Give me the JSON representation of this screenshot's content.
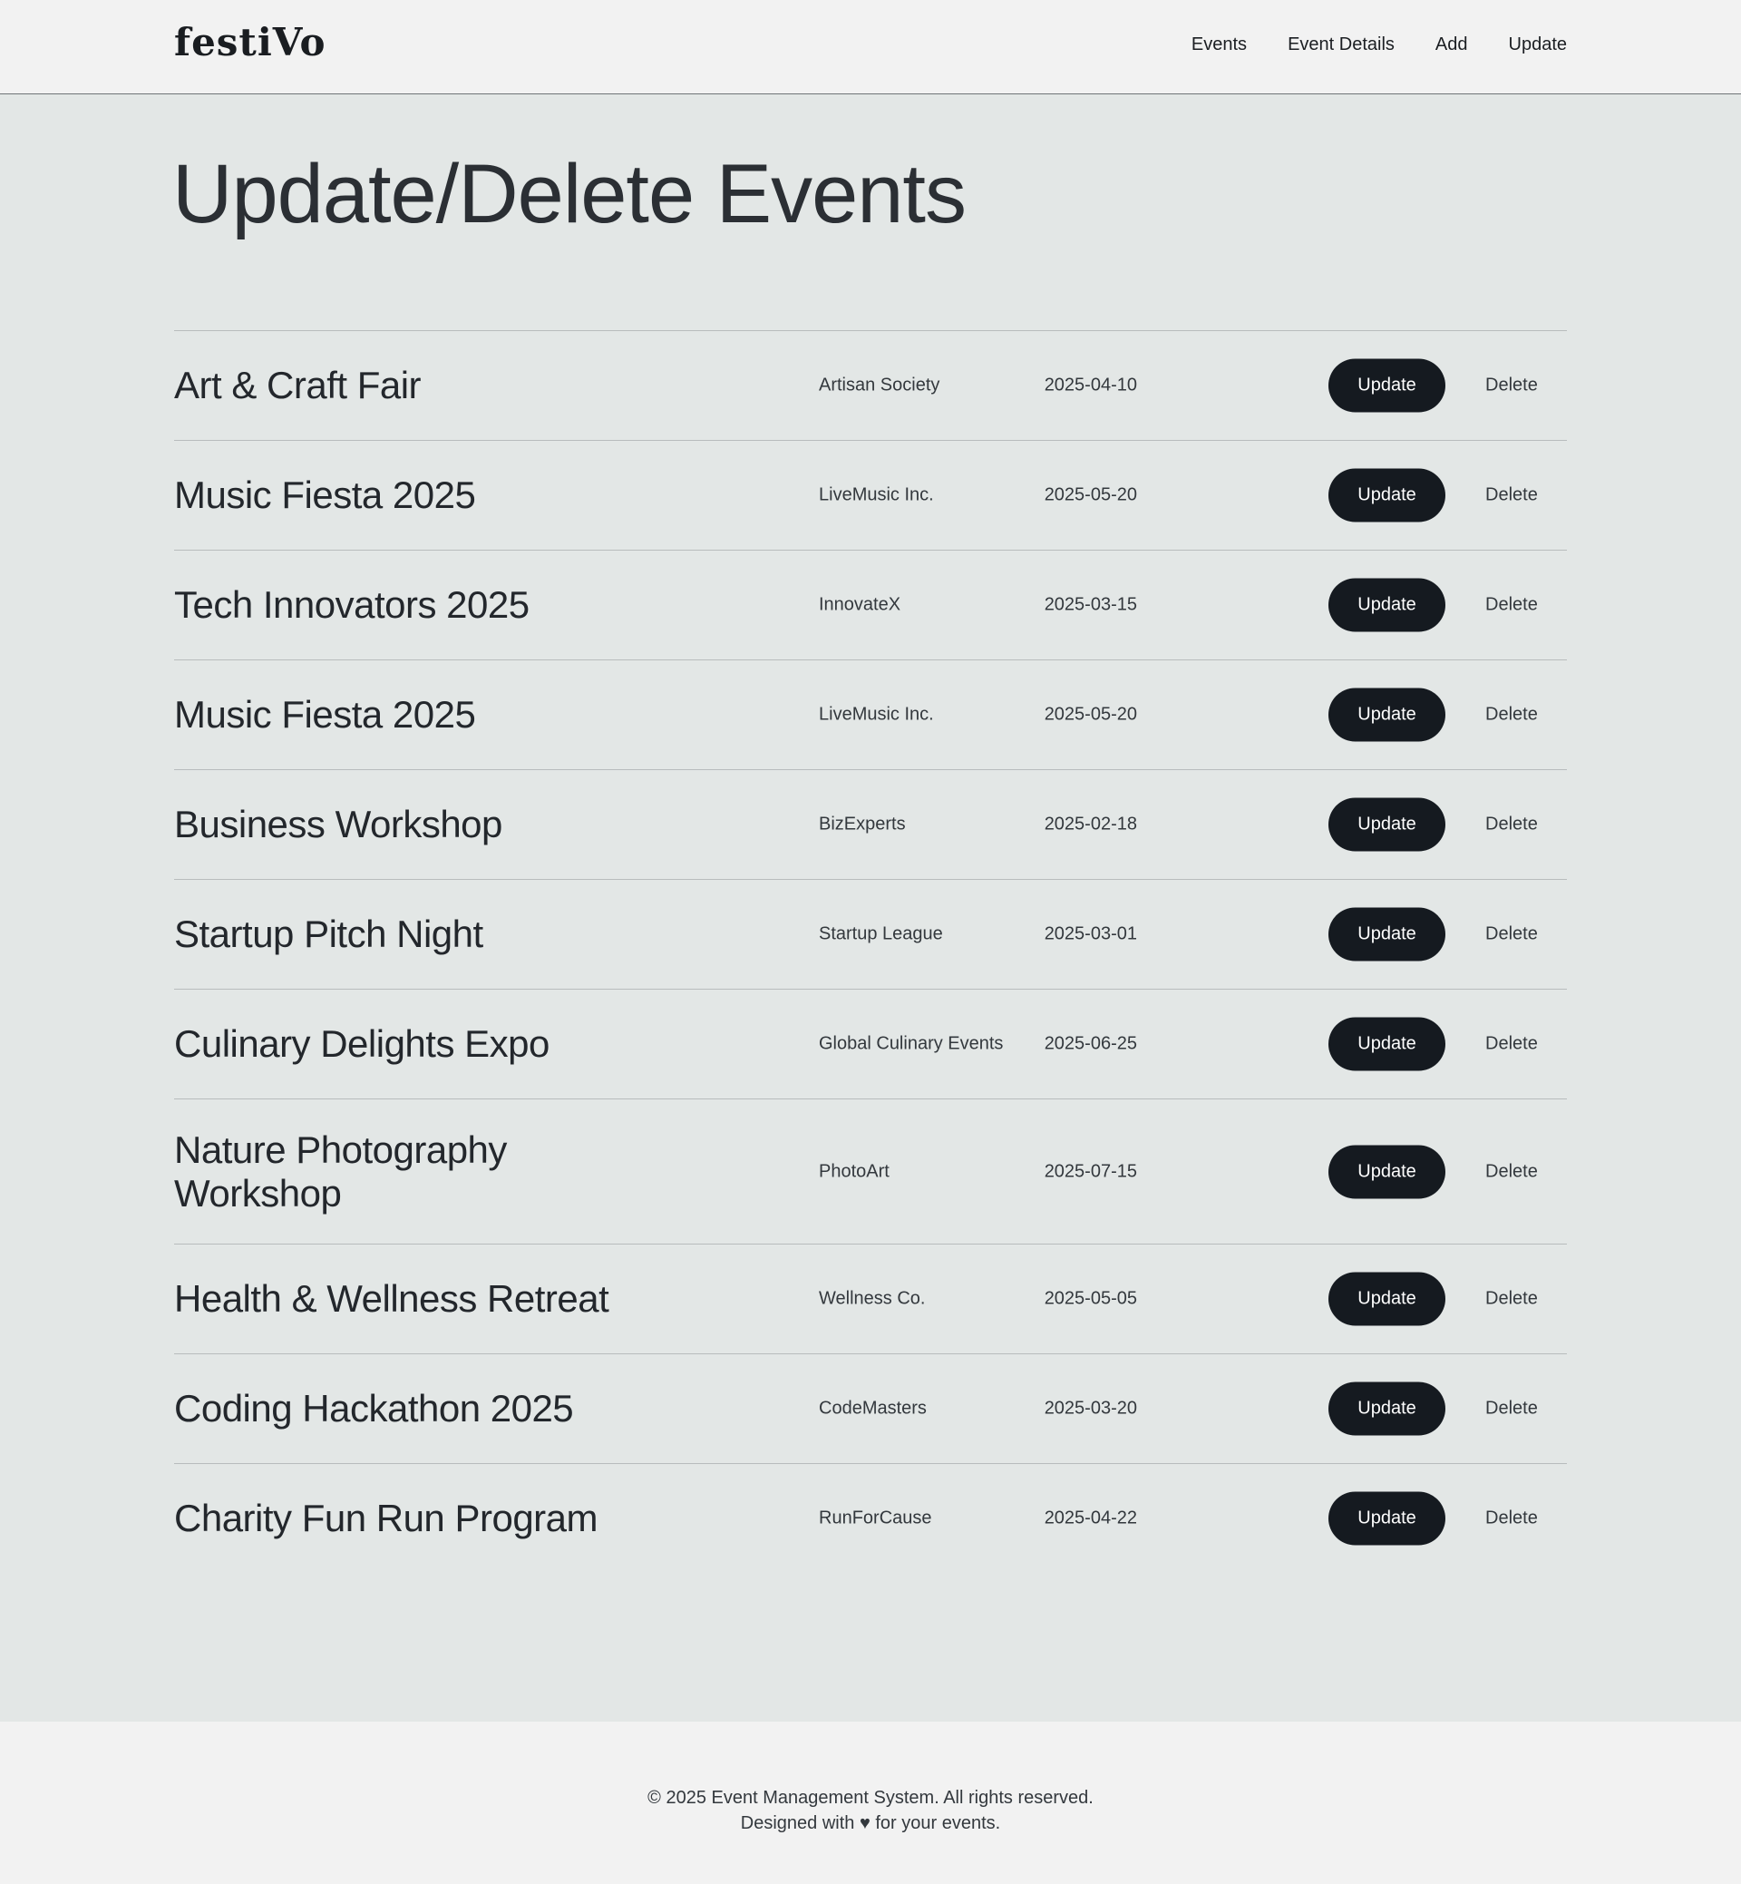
{
  "header": {
    "logo": "festiVo",
    "nav": [
      "Events",
      "Event Details",
      "Add",
      "Update"
    ]
  },
  "main": {
    "title": "Update/Delete Events",
    "update_label": "Update",
    "delete_label": "Delete",
    "events": [
      {
        "name": "Art & Craft Fair",
        "organizer": "Artisan Society",
        "date": "2025-04-10"
      },
      {
        "name": "Music Fiesta 2025",
        "organizer": "LiveMusic Inc.",
        "date": "2025-05-20"
      },
      {
        "name": "Tech Innovators 2025",
        "organizer": "InnovateX",
        "date": "2025-03-15"
      },
      {
        "name": "Music Fiesta 2025",
        "organizer": "LiveMusic Inc.",
        "date": "2025-05-20"
      },
      {
        "name": "Business Workshop",
        "organizer": "BizExperts",
        "date": "2025-02-18"
      },
      {
        "name": "Startup Pitch Night",
        "organizer": "Startup League",
        "date": "2025-03-01"
      },
      {
        "name": "Culinary Delights Expo",
        "organizer": "Global Culinary Events",
        "date": "2025-06-25"
      },
      {
        "name": "Nature Photography Workshop",
        "organizer": "PhotoArt",
        "date": "2025-07-15"
      },
      {
        "name": "Health & Wellness Retreat",
        "organizer": "Wellness Co.",
        "date": "2025-05-05"
      },
      {
        "name": "Coding Hackathon 2025",
        "organizer": "CodeMasters",
        "date": "2025-03-20"
      },
      {
        "name": "Charity Fun Run Program",
        "organizer": "RunForCause",
        "date": "2025-04-22"
      }
    ]
  },
  "footer": {
    "line1": "© 2025 Event Management System. All rights reserved.",
    "line2": "Designed with ♥ for your events."
  }
}
